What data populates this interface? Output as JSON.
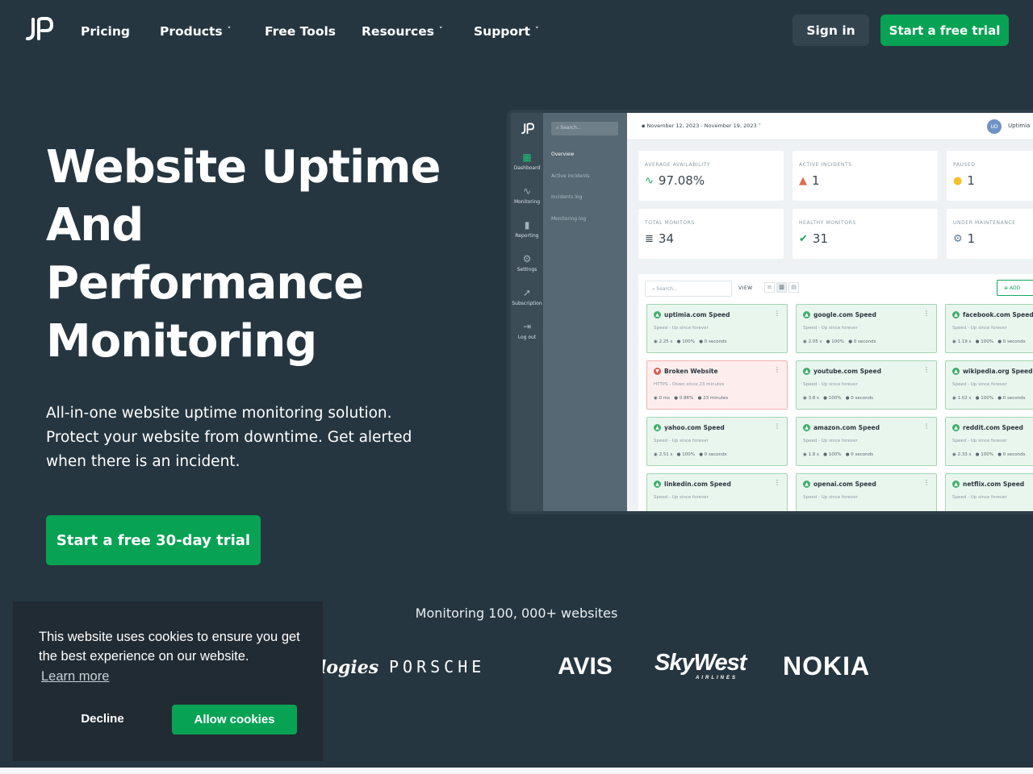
{
  "nav": {
    "logo_icon": "uptimia-logo-icon",
    "links": [
      {
        "label": "Pricing",
        "has_dropdown": false
      },
      {
        "label": "Products",
        "has_dropdown": true
      },
      {
        "label": "Free Tools",
        "has_dropdown": false
      },
      {
        "label": "Resources",
        "has_dropdown": true
      },
      {
        "label": "Support",
        "has_dropdown": true
      }
    ],
    "chevron": "˅",
    "signin_label": "Sign in",
    "trial_label": "Start a free trial"
  },
  "hero": {
    "title_lines": [
      "Website Uptime",
      "And",
      "Performance",
      "Monitoring"
    ],
    "subtitle": "All-in-one website uptime monitoring solution. Protect your website from downtime. Get alerted when there is an incident.",
    "cta_label": "Start a free 30-day trial"
  },
  "dashboard": {
    "rail": [
      {
        "label": "Dashboard",
        "icon": "grid-icon",
        "active": true
      },
      {
        "label": "Monitoring",
        "icon": "pulse-icon",
        "active": false
      },
      {
        "label": "Reporting",
        "icon": "file-icon",
        "active": false
      },
      {
        "label": "Settings",
        "icon": "gear-icon",
        "active": false
      },
      {
        "label": "Subscription",
        "icon": "rocket-icon",
        "active": false
      },
      {
        "label": "Log out",
        "icon": "logout-icon",
        "active": false
      }
    ],
    "search_placeholder": "Search...",
    "nav_items": [
      "Overview",
      "Active incidents",
      "Incidents log",
      "Monitoring log"
    ],
    "date_range": "November 12, 2023 - November 19, 2023",
    "user_initials": "UD",
    "user_name": "Uptimia",
    "stats": [
      {
        "label": "AVERAGE AVAILABILITY",
        "value": "97.08%",
        "icon": "pulse-icon",
        "color": "#18a760"
      },
      {
        "label": "ACTIVE INCIDENTS",
        "value": "1",
        "icon": "warning-icon",
        "color": "#e36a4f"
      },
      {
        "label": "PAUSED",
        "value": "1",
        "icon": "pause-icon",
        "color": "#f2c12e"
      },
      {
        "label": "TOTAL MONITORS",
        "value": "34",
        "icon": "server-icon",
        "color": "#3a4750"
      },
      {
        "label": "HEALTHY MONITORS",
        "value": "31",
        "icon": "check-circle-icon",
        "color": "#18a760"
      },
      {
        "label": "UNDER MAINTENANCE",
        "value": "1",
        "icon": "gears-icon",
        "color": "#5f7a95"
      }
    ],
    "panel": {
      "search_placeholder": "Search...",
      "view_label": "VIEW",
      "add_label": "ADD"
    },
    "monitors": [
      {
        "name": "uptimia.com Speed",
        "status": "up",
        "sub": "Speed - Up since forever",
        "time": "2.25 s",
        "uptime": "100%",
        "down": "0 seconds"
      },
      {
        "name": "google.com Speed",
        "status": "up",
        "sub": "Speed - Up since forever",
        "time": "2.05 s",
        "uptime": "100%",
        "down": "0 seconds"
      },
      {
        "name": "facebook.com Speed",
        "status": "up",
        "sub": "Speed - Up since forever",
        "time": "1.19 s",
        "uptime": "100%",
        "down": "0 seconds"
      },
      {
        "name": "Broken Website",
        "status": "down",
        "sub": "HTTPS - Down since 23 minutes",
        "time": "0 ms",
        "uptime": "0.86%",
        "down": "23 minutes"
      },
      {
        "name": "youtube.com Speed",
        "status": "up",
        "sub": "Speed - Up since forever",
        "time": "3.8 s",
        "uptime": "100%",
        "down": "0 seconds"
      },
      {
        "name": "wikipedia.org Speed",
        "status": "up",
        "sub": "Speed - Up since forever",
        "time": "1.02 s",
        "uptime": "100%",
        "down": "0 seconds"
      },
      {
        "name": "yahoo.com Speed",
        "status": "up",
        "sub": "Speed - Up since forever",
        "time": "2.51 s",
        "uptime": "100%",
        "down": "0 seconds"
      },
      {
        "name": "amazon.com Speed",
        "status": "up",
        "sub": "Speed - Up since forever",
        "time": "1.8 s",
        "uptime": "100%",
        "down": "0 seconds"
      },
      {
        "name": "reddit.com Speed",
        "status": "up",
        "sub": "Speed - Up since forever",
        "time": "2.33 s",
        "uptime": "100%",
        "down": "0 seconds"
      },
      {
        "name": "linkedin.com Speed",
        "status": "up",
        "sub": "Speed - Up since forever",
        "time": "",
        "uptime": "",
        "down": ""
      },
      {
        "name": "openai.com Speed",
        "status": "up",
        "sub": "Speed - Up since forever",
        "time": "",
        "uptime": "",
        "down": ""
      },
      {
        "name": "netflix.com Speed",
        "status": "up",
        "sub": "Speed - Up since forever",
        "time": "",
        "uptime": "",
        "down": ""
      }
    ]
  },
  "monitoring": {
    "text": "Monitoring 100, 000+ websites",
    "logos": [
      {
        "text": "logies",
        "name": "logo-technologies"
      },
      {
        "text": "PORSCHE",
        "name": "logo-porsche"
      },
      {
        "text": "AVIS",
        "name": "logo-avis"
      },
      {
        "text": "SkyWest",
        "name": "logo-skywest"
      },
      {
        "text": "AIRLINES",
        "name": "logo-skywest-subtitle"
      },
      {
        "text": "NOKIA",
        "name": "logo-nokia"
      }
    ]
  },
  "cookie": {
    "message": "This website uses cookies to ensure you get the best experience on our website.",
    "learn_more": "Learn more",
    "decline": "Decline",
    "allow": "Allow cookies"
  },
  "colors": {
    "background": "#263640",
    "accent": "#07a254",
    "cookie_bg": "#212b33"
  }
}
